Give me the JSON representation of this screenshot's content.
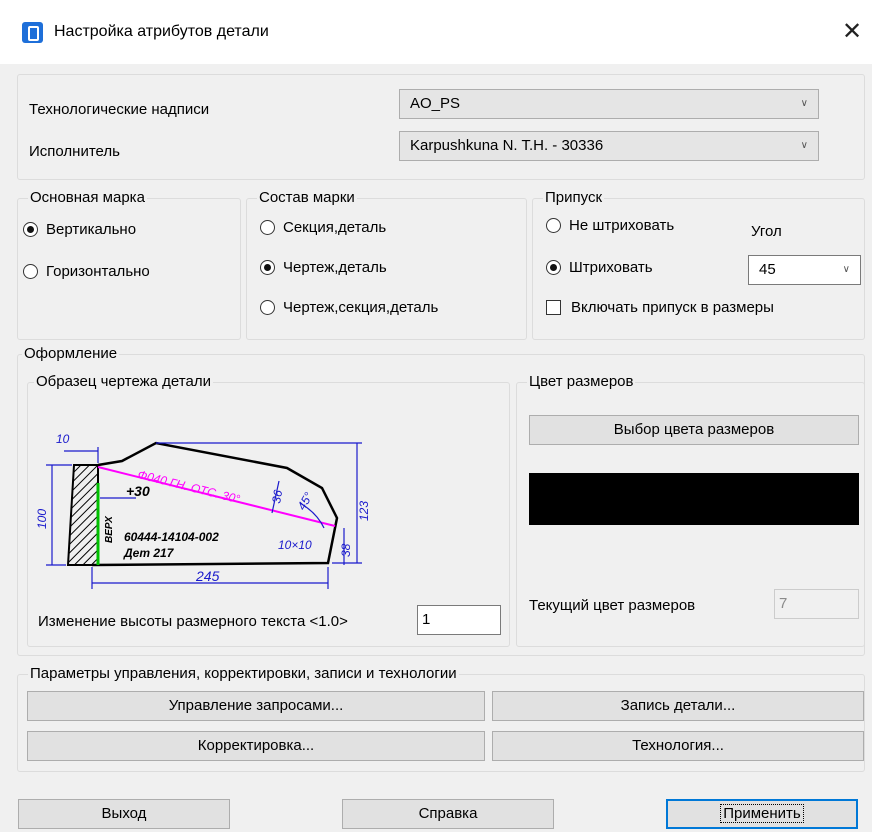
{
  "window": {
    "title": "Настройка атрибутов детали",
    "close": "✕"
  },
  "top": {
    "tech_label": "Технологические надписи",
    "tech_value": "AO_PS",
    "executor_label": "Исполнитель",
    "executor_value": "Karpushkuna N.  T.H. - 30336"
  },
  "main_mark": {
    "legend": "Основная марка",
    "options": [
      "Вертикально",
      "Горизонтально"
    ],
    "selected": 0
  },
  "mark_comp": {
    "legend": "Состав марки",
    "options": [
      "Секция,деталь",
      "Чертеж,деталь",
      "Чертеж,секция,деталь"
    ],
    "selected": 1
  },
  "allowance": {
    "legend": "Припуск",
    "options": [
      "Не штриховать",
      "Штриховать"
    ],
    "selected": 1,
    "angle_label": "Угол",
    "angle_value": "45",
    "include_label": "Включать припуск в размеры",
    "include_checked": false
  },
  "design": {
    "legend": "Оформление",
    "sample_legend": "Образец чертежа детали",
    "height_label": "Изменение высоты размерного текста <1.0>",
    "height_value": "1",
    "drawing": {
      "dim_10": "10",
      "dim_100": "100",
      "plus30": "+30",
      "magenta_text": "Ф040 ГН. ОТС. 30°",
      "dim_36": "36",
      "dim_45": "45°",
      "dim_123": "123",
      "vert": "ВЕРХ",
      "part_no": "60444-14104-002",
      "det": "Дет 217",
      "dim_10x10": "10×10",
      "dim_38": "38",
      "dim_245": "245"
    }
  },
  "color": {
    "legend": "Цвет размеров",
    "select_btn": "Выбор цвета размеров",
    "swatch_color": "#000000",
    "current_label": "Текущий цвет размеров",
    "current_value": "7"
  },
  "params": {
    "legend": "Параметры управления, корректировки, записи и технологии",
    "btn_requests": "Управление запросами...",
    "btn_record": "Запись детали...",
    "btn_correct": "Корректировка...",
    "btn_tech": "Технология..."
  },
  "footer": {
    "exit": "Выход",
    "help": "Справка",
    "apply": "Применить"
  }
}
